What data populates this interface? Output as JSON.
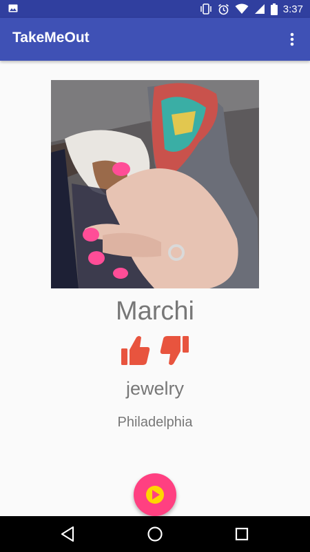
{
  "status_bar": {
    "time": "3:37",
    "icons": [
      "image-icon",
      "vibrate-icon",
      "alarm-icon",
      "wifi-icon",
      "signal-icon",
      "battery-icon"
    ]
  },
  "app_bar": {
    "title": "TakeMeOut",
    "overflow_icon": "more-vert-icon"
  },
  "place": {
    "name": "Marchi",
    "category": "jewelry",
    "city": "Philadelphia",
    "photo_icon": "place-photo"
  },
  "actions": {
    "thumbs_up_icon": "thumbs-up-icon",
    "thumbs_down_icon": "thumbs-down-icon",
    "fab_icon": "play-icon"
  },
  "colors": {
    "status_bar": "#303f9f",
    "app_bar": "#3f51b5",
    "fab": "#ff4081",
    "play_icon": "#ffd600",
    "thumbs": "#e8543e",
    "text": "#777777"
  },
  "nav_bar": {
    "icons": [
      "back-icon",
      "home-icon",
      "recents-icon"
    ]
  }
}
